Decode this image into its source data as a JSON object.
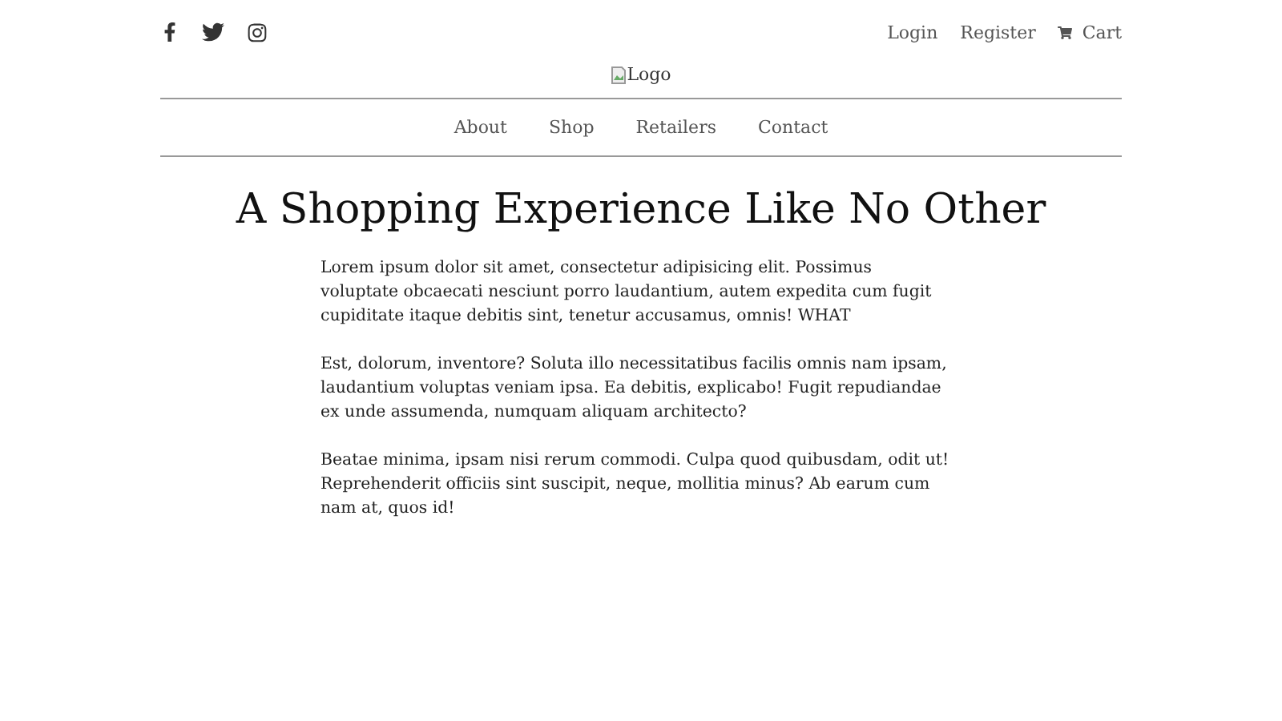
{
  "social_links": [
    {
      "kind": "facebook"
    },
    {
      "kind": "twitter"
    },
    {
      "kind": "instagram"
    }
  ],
  "account_links": [
    {
      "label": "Login"
    },
    {
      "label": "Register"
    },
    {
      "label": "Cart",
      "kind": "cart"
    }
  ],
  "logo": {
    "alt": "Logo"
  },
  "nav": [
    {
      "label": "About"
    },
    {
      "label": "Shop"
    },
    {
      "label": "Retailers"
    },
    {
      "label": "Contact"
    }
  ],
  "heading": "A Shopping Experience Like No Other",
  "paragraphs": [
    "Lorem ipsum dolor sit amet, consectetur adipisicing elit. Possimus voluptate obcaecati nesciunt porro laudantium, autem expedita cum fugit cupiditate itaque debitis sint, tenetur accusamus, omnis! WHAT",
    "Est, dolorum, inventore? Soluta illo necessitatibus facilis omnis nam ipsam, laudantium voluptas veniam ipsa. Ea debitis, explicabo! Fugit repudiandae ex unde assumenda, numquam aliquam architecto?",
    "Beatae minima, ipsam nisi rerum commodi. Culpa quod quibusdam, odit ut! Reprehenderit officiis sint suscipit, neque, mollitia minus? Ab earum cum nam at, quos id!"
  ]
}
